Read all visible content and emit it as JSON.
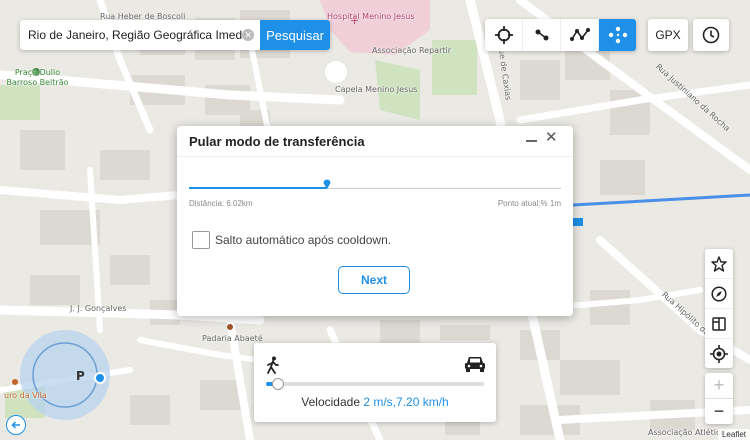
{
  "search": {
    "value": "Rio de Janeiro, Região Geográfica Imediata do",
    "button_label": "Pesquisar"
  },
  "toolbar": {
    "modes": [
      "crosshair-icon",
      "two-spot-route-icon",
      "multi-spot-route-icon",
      "jump-teleport-icon"
    ],
    "active_mode": "jump-teleport-icon",
    "gpx_label": "GPX",
    "history_icon": "clock-icon"
  },
  "map": {
    "labels": {
      "rua_heber": "Rua Heber de Boscoli",
      "hospital": "Hospital Menino Jesus",
      "associacao": "Associação Repartir",
      "capela": "Capela Menino Jesus",
      "praca": "Praça Dulio Barroso Beltrão",
      "duque": "R. Duque de Caxias",
      "justiniano": "Rua Justiniano da Rocha",
      "jj": "J. J. Gonçalves",
      "padaria": "Padaria Abaeté",
      "hipolito": "Rua Hipólito da Costa",
      "vila": "uro da Vila",
      "atletica": "Associação Atlética"
    },
    "marker_letter": "P",
    "attribution": "Leaflet",
    "route_color": "#4a8fe8",
    "accent_color": "#1e90e8"
  },
  "dialog": {
    "title": "Pular modo de transferência",
    "distance": "Distância: 6.02km",
    "current_point": "Ponto atual:% 1m",
    "checkbox_label": "Salto automático após cooldown.",
    "checkbox_checked": false,
    "next_label": "Next",
    "progress": 0.37
  },
  "speed": {
    "label": "Velocidade",
    "value": "2 m/s,7.20 km/h",
    "level": 0.05,
    "icons": [
      "walk-icon",
      "car-icon"
    ]
  },
  "side_tools": [
    "star-icon",
    "compass-icon",
    "map-book-icon",
    "locate-icon"
  ],
  "zoom": {
    "in": "+",
    "out": "−"
  }
}
